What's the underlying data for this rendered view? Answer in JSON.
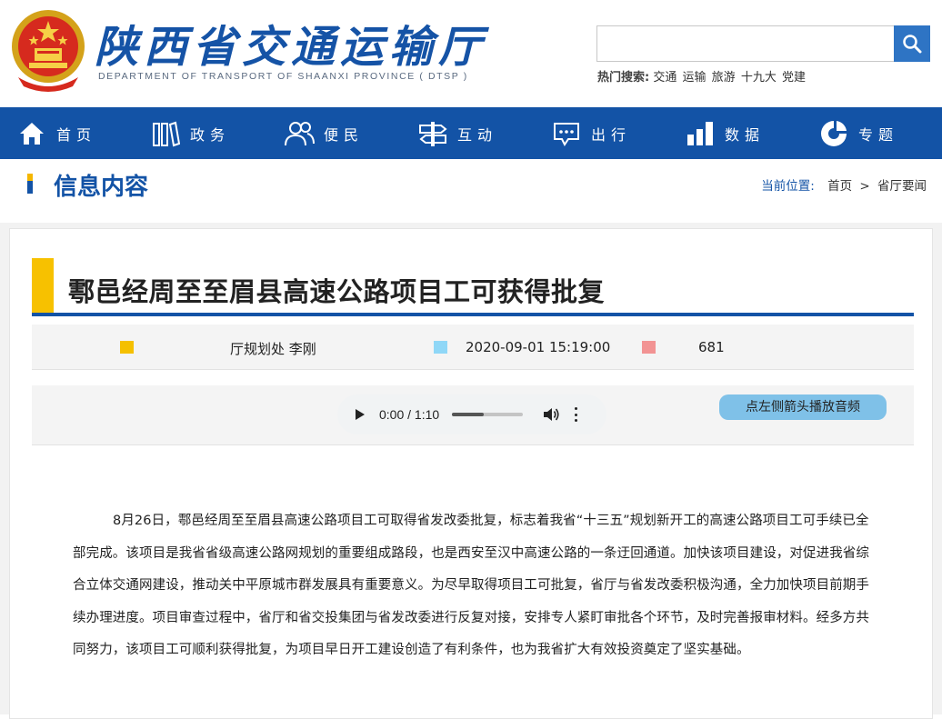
{
  "header": {
    "site_title": "陕西省交通运输厅",
    "site_subtitle": "DEPARTMENT OF TRANSPORT OF SHAANXI PROVINCE ( DTSP )",
    "search_placeholder": "",
    "hot_label": "热门搜索:",
    "hot_links": [
      "交通",
      "运输",
      "旅游",
      "十九大",
      "党建"
    ]
  },
  "nav": {
    "items": [
      {
        "label": "首页",
        "icon": "home-icon"
      },
      {
        "label": "政务",
        "icon": "books-icon"
      },
      {
        "label": "便民",
        "icon": "people-icon"
      },
      {
        "label": "互动",
        "icon": "signpost-icon"
      },
      {
        "label": "出行",
        "icon": "chat-icon"
      },
      {
        "label": "数据",
        "icon": "bar-chart-icon"
      },
      {
        "label": "专题",
        "icon": "pie-icon"
      }
    ],
    "colors": {
      "bg": "#1353a6"
    }
  },
  "section": {
    "title": "信息内容",
    "breadcrumb_label": "当前位置:",
    "breadcrumb_home": "首页",
    "breadcrumb_sep": ">",
    "breadcrumb_current": "省厅要闻"
  },
  "article": {
    "title": "鄠邑经周至至眉县高速公路项目工可获得批复",
    "author": "厅规划处 李刚",
    "datetime": "2020-09-01 15:19:00",
    "views": "681",
    "meta_colors": {
      "author": "#f5c000",
      "date": "#8fd7f7",
      "views": "#f29393"
    },
    "audio": {
      "time": "0:00 / 1:10",
      "progress": 0.45,
      "hint": "点左侧箭头播放音频"
    },
    "body": "8月26日，鄠邑经周至至眉县高速公路项目工可取得省发改委批复，标志着我省“十三五”规划新开工的高速公路项目工可手续已全部完成。该项目是我省省级高速公路网规划的重要组成路段，也是西安至汉中高速公路的一条迂回通道。加快该项目建设，对促进我省综合立体交通网建设，推动关中平原城市群发展具有重要意义。为尽早取得项目工可批复，省厅与省发改委积极沟通，全力加快项目前期手续办理进度。项目审查过程中，省厅和省交投集团与省发改委进行反复对接，安排专人紧盯审批各个环节，及时完善报审材料。经多方共同努力，该项目工可顺利获得批复，为项目早日开工建设创造了有利条件，也为我省扩大有效投资奠定了坚实基础。"
  }
}
